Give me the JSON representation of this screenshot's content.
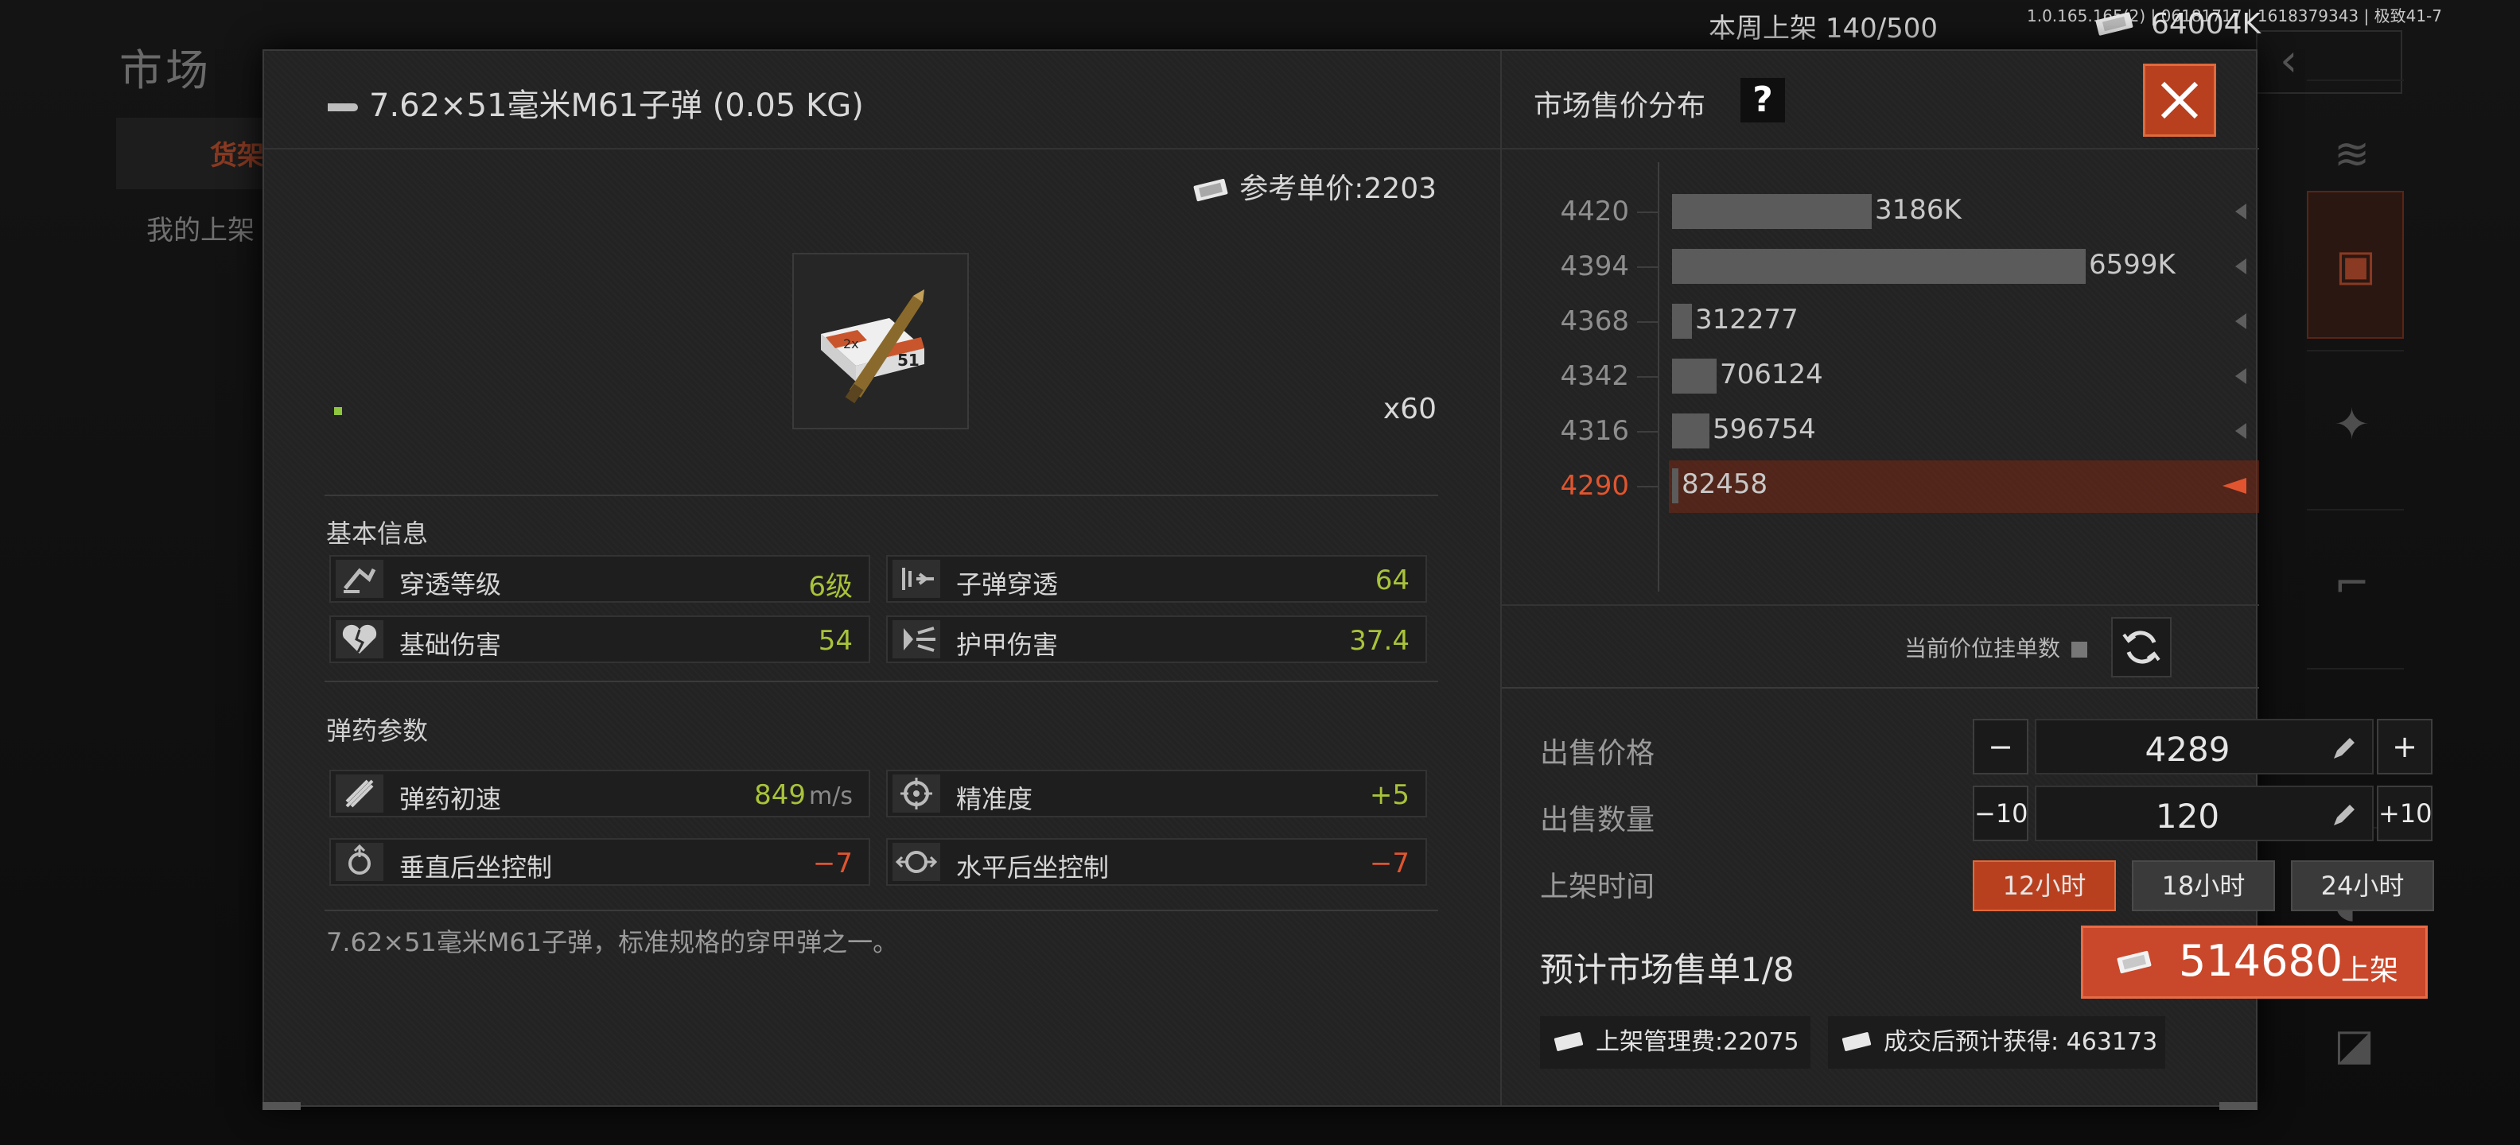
{
  "background": {
    "page_title": "市场",
    "tab_label": "货架",
    "my_listings_label": "我的上架",
    "weekly_label": "本周上架",
    "weekly_count": "140/500",
    "money": "64004K",
    "version": "1.0.165.165(2) | 06181717 | 1618379343 | 极致41-7"
  },
  "item": {
    "title": "7.62×51毫米M61子弹 (0.05 KG)",
    "ref_price_label": "参考单价:2203",
    "count": "x60",
    "description": "7.62×51毫米M61子弹，标准规格的穿甲弹之一。"
  },
  "basic_info": {
    "section_label": "基本信息",
    "stats": [
      {
        "name": "穿透等级",
        "value": "6级",
        "icon": "penetration-level-icon"
      },
      {
        "name": "子弹穿透",
        "value": "64",
        "icon": "bullet-penetration-icon"
      },
      {
        "name": "基础伤害",
        "value": "54",
        "icon": "broken-heart-icon"
      },
      {
        "name": "护甲伤害",
        "value": "37.4",
        "icon": "armor-damage-icon"
      }
    ]
  },
  "ammo_params": {
    "section_label": "弹药参数",
    "stats": [
      {
        "name": "弹药初速",
        "value": "849",
        "unit": "m/s",
        "icon": "velocity-icon"
      },
      {
        "name": "精准度",
        "value": "+5",
        "icon": "crosshair-icon"
      },
      {
        "name": "垂直后坐控制",
        "value": "−7",
        "icon": "vertical-recoil-icon"
      },
      {
        "name": "水平后坐控制",
        "value": "−7",
        "icon": "horizontal-recoil-icon"
      }
    ]
  },
  "market": {
    "title": "市场售价分布",
    "help_label": "?",
    "current_count_label": "当前价位挂单数",
    "colors": {
      "accent": "#e0552f",
      "good": "#a8c33a",
      "bar": "#5b5b5b"
    }
  },
  "chart_data": {
    "type": "bar",
    "orientation": "horizontal",
    "categories": [
      "4420",
      "4394",
      "4368",
      "4342",
      "4316",
      "4290"
    ],
    "values": [
      3186000,
      6599000,
      312277,
      706124,
      596754,
      82458
    ],
    "value_labels": [
      "3186K",
      "6599K",
      "312277",
      "706124",
      "596754",
      "82458"
    ],
    "highlight_category": "4290"
  },
  "sell_form": {
    "price_label": "出售价格",
    "price_value": "4289",
    "minus_label": "−",
    "plus_label": "+",
    "qty_label": "出售数量",
    "qty_value": "120",
    "minus10_label": "−10",
    "plus10_label": "+10",
    "time_label": "上架时间",
    "durations": [
      "12小时",
      "18小时",
      "24小时"
    ],
    "selected_duration": "12小时",
    "forecast_label": "预计市场售单1/8",
    "list_amount": "514680",
    "list_label": "上架",
    "fee_label": "上架管理费:22075",
    "net_label": "成交后预计获得: 463173"
  }
}
